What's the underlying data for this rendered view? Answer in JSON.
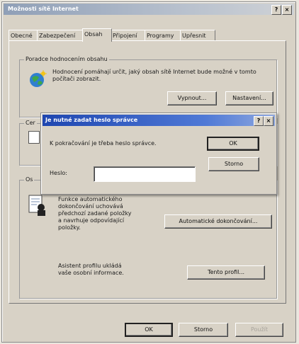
{
  "window": {
    "title": "Možnosti sítě Internet",
    "help_glyph": "?",
    "close_glyph": "×"
  },
  "tabs": [
    {
      "label": "Obecné"
    },
    {
      "label": "Zabezpečení"
    },
    {
      "label": "Obsah"
    },
    {
      "label": "Připojení"
    },
    {
      "label": "Programy"
    },
    {
      "label": "Upřesnit"
    }
  ],
  "content_advisor": {
    "group_label": "Poradce hodnocením obsahu",
    "description": "Hodnocení pomáhají určit, jaký obsah sítě Internet bude možné v tomto počítači zobrazit.",
    "disable_button": "Vypnout...",
    "settings_button": "Nastavení..."
  },
  "certificates_group_label": "Cer",
  "personal_group_label": "Os",
  "autocomplete": {
    "text": "Funkce automatického dokončování uchovává předchozí zadané položky a navrhuje odpovídající položky.",
    "button": "Automatické dokončování..."
  },
  "profile": {
    "text": "Asistent profilu ukládá vaše osobní informace.",
    "button": "Tento profil..."
  },
  "footer": {
    "ok": "OK",
    "cancel": "Storno",
    "apply": "Použít"
  },
  "password_dialog": {
    "title": "Je nutné zadat heslo správce",
    "help_glyph": "?",
    "close_glyph": "×",
    "message": "K pokračování je třeba heslo správce.",
    "password_label": "Heslo:",
    "password_value": "",
    "ok": "OK",
    "cancel": "Storno"
  },
  "colors": {
    "face": "#d8d2c6",
    "dialog_title": "#1e46b0"
  }
}
